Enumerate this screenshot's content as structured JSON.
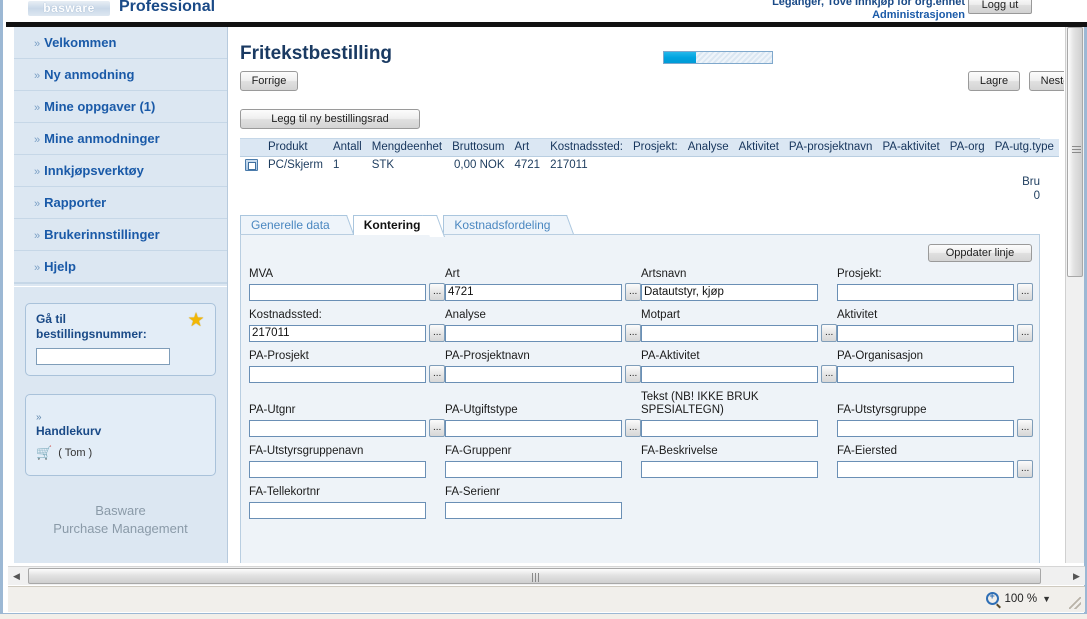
{
  "header": {
    "logo": "basware",
    "product": "Professional",
    "user_line1": "Leganger, Tove  Innkjøp for org.enhet",
    "user_line2": "Administrasjonen",
    "logout_label": "Logg ut"
  },
  "sidebar": {
    "items": [
      {
        "label": "Velkommen"
      },
      {
        "label": "Ny anmodning"
      },
      {
        "label": "Mine oppgaver (1)"
      },
      {
        "label": "Mine anmodninger"
      },
      {
        "label": "Innkjøpsverktøy"
      },
      {
        "label": "Rapporter"
      },
      {
        "label": "Brukerinnstillinger"
      },
      {
        "label": "Hjelp"
      }
    ],
    "goto_order": {
      "title": "Gå til bestillingsnummer:",
      "value": "",
      "star_icon": "star-icon"
    },
    "cart": {
      "title": "Handlekurv",
      "status": "( Tom )",
      "cart_icon": "shopping-cart-icon"
    },
    "brand_line1": "Basware",
    "brand_line2": "Purchase Management"
  },
  "main": {
    "page_title": "Fritekstbestilling",
    "progress_percent": 30,
    "buttons": {
      "previous": "Forrige",
      "save": "Lagre",
      "next": "Neste",
      "add_row": "Legg til ny bestillingsrad",
      "update_line": "Oppdater linje"
    },
    "table": {
      "columns": [
        "",
        "Produkt",
        "Antall",
        "Mengdeenhet",
        "Bruttosum",
        "Art",
        "Kostnadssted:",
        "Prosjekt:",
        "Analyse",
        "Aktivitet",
        "PA-prosjektnavn",
        "PA-aktivitet",
        "PA-org",
        "PA-utg.type"
      ],
      "rows": [
        {
          "icon": "line-item-icon",
          "produkt": "PC/Skjerm",
          "antall": "1",
          "mengdeenhet": "STK",
          "bruttosum": "0,00 NOK",
          "art": "4721",
          "kostnadssted": "217011",
          "prosjekt": "",
          "analyse": "",
          "aktivitet": "",
          "pa_prosjektnavn": "",
          "pa_aktivitet": "",
          "pa_org": "",
          "pa_utg_type": ""
        }
      ],
      "total_label": "Bru",
      "total_value": "0"
    },
    "tabs": [
      {
        "label": "Generelle data",
        "active": false
      },
      {
        "label": "Kontering",
        "active": true
      },
      {
        "label": "Kostnadsfordeling",
        "active": false
      }
    ],
    "form": {
      "rows": [
        [
          {
            "label": "MVA",
            "value": "",
            "lookup": true
          },
          {
            "label": "Art",
            "value": "4721",
            "lookup": true
          },
          {
            "label": "Artsnavn",
            "value": "Datautstyr, kjøp",
            "lookup": false
          },
          {
            "label": "Prosjekt:",
            "value": "",
            "lookup": true
          }
        ],
        [
          {
            "label": "Kostnadssted:",
            "value": "217011",
            "lookup": true
          },
          {
            "label": "Analyse",
            "value": "",
            "lookup": true
          },
          {
            "label": "Motpart",
            "value": "",
            "lookup": true
          },
          {
            "label": "Aktivitet",
            "value": "",
            "lookup": true
          }
        ],
        [
          {
            "label": "PA-Prosjekt",
            "value": "",
            "lookup": true
          },
          {
            "label": "PA-Prosjektnavn",
            "value": "",
            "lookup": true
          },
          {
            "label": "PA-Aktivitet",
            "value": "",
            "lookup": true
          },
          {
            "label": "PA-Organisasjon",
            "value": "",
            "lookup": false
          }
        ],
        [
          {
            "label": "PA-Utgnr",
            "value": "",
            "lookup": true
          },
          {
            "label": "PA-Utgiftstype",
            "value": "",
            "lookup": true
          },
          {
            "label": "Tekst (NB! IKKE BRUK SPESIALTEGN)",
            "value": "",
            "lookup": false,
            "two_line": true
          },
          {
            "label": "FA-Utstyrsgruppe",
            "value": "",
            "lookup": true
          }
        ],
        [
          {
            "label": "FA-Utstyrsgruppenavn",
            "value": "",
            "lookup": false
          },
          {
            "label": "FA-Gruppenr",
            "value": "",
            "lookup": false
          },
          {
            "label": "FA-Beskrivelse",
            "value": "",
            "lookup": false
          },
          {
            "label": "FA-Eiersted",
            "value": "",
            "lookup": true
          }
        ],
        [
          {
            "label": "FA-Tellekortnr",
            "value": "",
            "lookup": false
          },
          {
            "label": "FA-Serienr",
            "value": "",
            "lookup": false
          }
        ]
      ]
    }
  },
  "statusbar": {
    "zoom_level": "100 %",
    "zoom_icon": "magnifier-plus-icon",
    "caret_icon": "chevron-down-icon"
  },
  "scrollbars": {
    "left_arrow": "◀",
    "right_arrow": "▶"
  }
}
